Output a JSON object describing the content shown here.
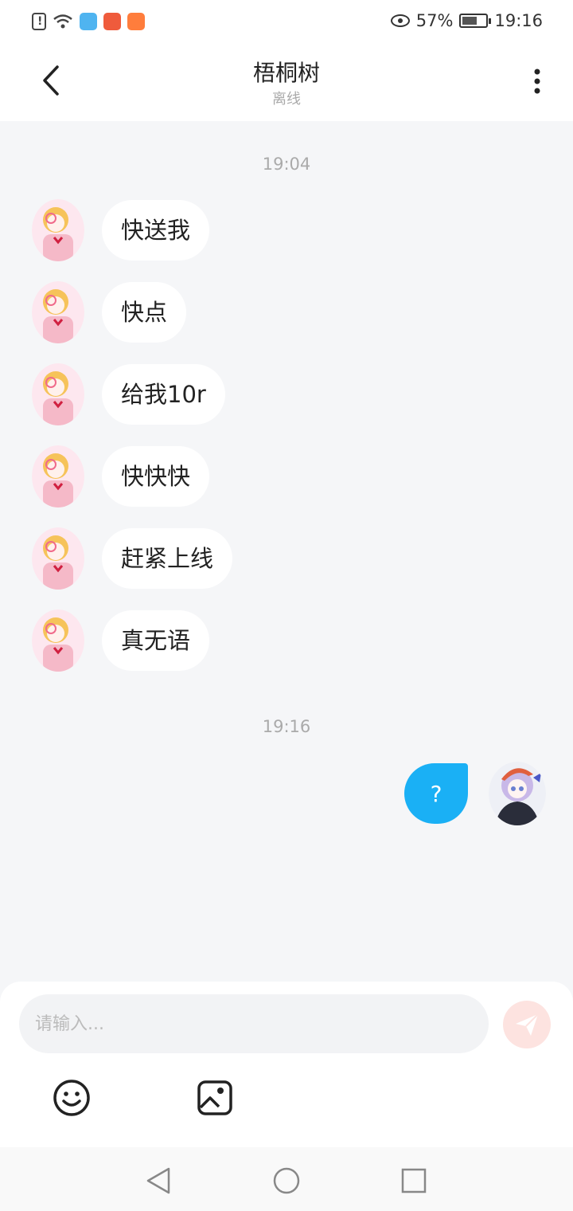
{
  "status_bar": {
    "battery": "57%",
    "time": "19:16",
    "icons": [
      "alert-icon",
      "wifi-icon",
      "shield-app-icon",
      "huawei-app-icon",
      "video-app-icon",
      "eye-icon",
      "battery-icon"
    ]
  },
  "header": {
    "title": "梧桐树",
    "status": "离线",
    "back_icon": "chevron-left-icon",
    "more_icon": "more-vertical-icon"
  },
  "chat": {
    "timestamps": [
      "19:04",
      "19:16"
    ],
    "incoming": [
      {
        "text": "快送我"
      },
      {
        "text": "快点"
      },
      {
        "text": "给我10r"
      },
      {
        "text": "快快快"
      },
      {
        "text": "赶紧上线"
      },
      {
        "text": "真无语"
      }
    ],
    "outgoing": [
      {
        "text": "?"
      }
    ]
  },
  "composer": {
    "placeholder": "请输入...",
    "send_icon": "send-icon",
    "tools": [
      "emoji-icon",
      "image-icon"
    ]
  },
  "colors": {
    "outgoing_bubble": "#1ab0f5",
    "send_button": "#fde3e0",
    "background": "#f5f6f8"
  }
}
